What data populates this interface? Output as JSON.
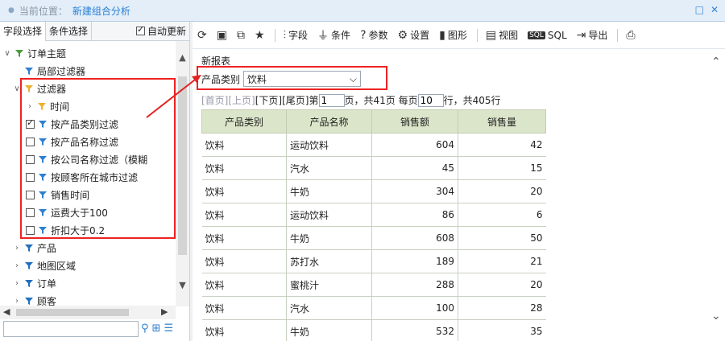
{
  "titlebar": {
    "location_label": "当前位置：",
    "location_value": "新建组合分析"
  },
  "left_panel": {
    "tabs": [
      "字段选择",
      "条件选择"
    ],
    "auto_update_label": "自动更新",
    "tree": [
      {
        "label": "订单主题",
        "level": 0,
        "expanded": true,
        "icon": "subject-icon"
      },
      {
        "label": "局部过滤器",
        "level": 1,
        "icon": "local-filter-icon"
      },
      {
        "label": "过滤器",
        "level": 1,
        "expanded": true,
        "icon": "folder-filter-icon"
      },
      {
        "label": "时间",
        "level": 2,
        "expanded": false,
        "icon": "folder-filter-icon"
      },
      {
        "label": "按产品类别过滤",
        "level": 2,
        "checked": true,
        "icon": "filter-icon"
      },
      {
        "label": "按产品名称过滤",
        "level": 2,
        "checked": false,
        "icon": "filter-icon"
      },
      {
        "label": "按公司名称过滤（模糊",
        "level": 2,
        "checked": false,
        "icon": "filter-icon"
      },
      {
        "label": "按顾客所在城市过滤",
        "level": 2,
        "checked": false,
        "icon": "filter-icon"
      },
      {
        "label": "销售时间",
        "level": 2,
        "checked": false,
        "icon": "filter-icon"
      },
      {
        "label": "运费大于100",
        "level": 2,
        "checked": false,
        "icon": "filter-icon"
      },
      {
        "label": "折扣大于0.2",
        "level": 2,
        "checked": false,
        "icon": "filter-icon"
      },
      {
        "label": "产品",
        "level": 1,
        "expanded": false,
        "icon": "table-filter-icon"
      },
      {
        "label": "地图区域",
        "level": 1,
        "expanded": false,
        "icon": "table-filter-icon"
      },
      {
        "label": "订单",
        "level": 1,
        "expanded": false,
        "icon": "table-filter-icon"
      },
      {
        "label": "顾客",
        "level": 1,
        "expanded": false,
        "icon": "table-filter-icon"
      }
    ],
    "search_placeholder": ""
  },
  "toolbar": {
    "items": [
      {
        "label": "",
        "icon": "refresh-icon"
      },
      {
        "label": "",
        "icon": "save-icon"
      },
      {
        "label": "",
        "icon": "save-as-icon"
      },
      {
        "label": "",
        "icon": "star-icon"
      },
      {
        "label": "字段",
        "icon": "field-icon"
      },
      {
        "label": "条件",
        "icon": "condition-icon"
      },
      {
        "label": "参数",
        "icon": "param-icon"
      },
      {
        "label": "设置",
        "icon": "gear-icon"
      },
      {
        "label": "图形",
        "icon": "chart-icon"
      },
      {
        "label": "视图",
        "icon": "view-icon"
      },
      {
        "label": "SQL",
        "icon": "sql-icon"
      },
      {
        "label": "导出",
        "icon": "export-icon"
      },
      {
        "label": "",
        "icon": "print-icon"
      }
    ]
  },
  "report": {
    "title": "新报表",
    "param_label": "产品类别",
    "param_value": "饮料",
    "pager": {
      "first": "[首页]",
      "prev": "[上页]",
      "next": "[下页]",
      "last": "[尾页]",
      "page_label": "第",
      "page_value": "1",
      "pages_text": "页，共41页 每页",
      "per_page_value": "10",
      "rows_text": "行，共405行"
    },
    "columns": [
      "产品类别",
      "产品名称",
      "销售额",
      "销售量"
    ],
    "rows": [
      [
        "饮料",
        "运动饮料",
        "604",
        "42"
      ],
      [
        "饮料",
        "汽水",
        "45",
        "15"
      ],
      [
        "饮料",
        "牛奶",
        "304",
        "20"
      ],
      [
        "饮料",
        "运动饮料",
        "86",
        "6"
      ],
      [
        "饮料",
        "牛奶",
        "608",
        "50"
      ],
      [
        "饮料",
        "苏打水",
        "189",
        "21"
      ],
      [
        "饮料",
        "蜜桃汁",
        "288",
        "20"
      ],
      [
        "饮料",
        "汽水",
        "100",
        "28"
      ],
      [
        "饮料",
        "牛奶",
        "532",
        "35"
      ]
    ]
  },
  "colors": {
    "accent": "#2a7fd4",
    "highlight_red": "#e22222",
    "header_green": "#dbe5c9"
  }
}
